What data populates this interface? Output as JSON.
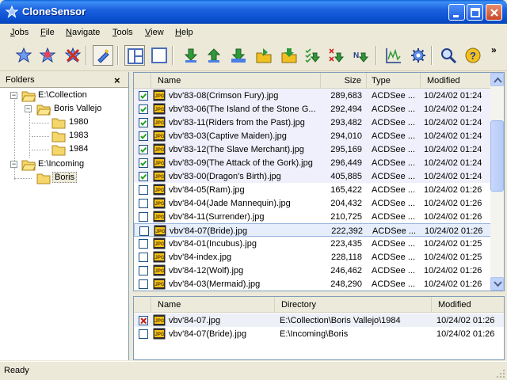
{
  "window": {
    "title": "CloneSensor"
  },
  "menu": [
    {
      "label": "Jobs",
      "u": "J",
      "rest": "obs"
    },
    {
      "label": "File",
      "u": "F",
      "rest": "ile"
    },
    {
      "label": "Navigate",
      "u": "N",
      "rest": "avigate"
    },
    {
      "label": "Tools",
      "u": "T",
      "rest": "ools"
    },
    {
      "label": "View",
      "u": "V",
      "rest": "iew"
    },
    {
      "label": "Help",
      "u": "H",
      "rest": "elp"
    }
  ],
  "toolbar": {
    "icons": [
      "new-job-icon",
      "edit-job-icon",
      "delete-job-icon",
      "auto-mark-icon",
      "split-view-icon",
      "single-view-icon",
      "download-icon",
      "upload-icon",
      "import-icon",
      "open-folder-icon",
      "move-icon",
      "check-all-icon",
      "uncheck-all-icon",
      "next-icon",
      "chart-icon",
      "settings-icon",
      "search-icon",
      "help-icon"
    ],
    "overflow": "»",
    "colors": {
      "green": "#2f9a3a",
      "blue": "#2a5fc8",
      "red": "#d02a20",
      "yellow": "#f0c020"
    }
  },
  "folders": {
    "title": "Folders",
    "close": "×",
    "tree": [
      {
        "label": "E:\\Collection",
        "expander": "−"
      },
      {
        "label": "Boris Vallejo",
        "expander": "−"
      },
      {
        "label": "1980"
      },
      {
        "label": "1983"
      },
      {
        "label": "1984"
      },
      {
        "label": "E:\\Incoming",
        "expander": "−"
      },
      {
        "label": "Boris",
        "selected": true
      }
    ]
  },
  "filelist": {
    "columns": {
      "name": "Name",
      "size": "Size",
      "type": "Type",
      "modified": "Modified"
    },
    "rows": [
      {
        "name": "vbv'83-08(Crimson Fury).jpg",
        "size": "289,683",
        "type": "ACDSee ...",
        "modified": "10/24/02 01:24",
        "checked": true
      },
      {
        "name": "vbv'83-06(The Island of the Stone G...",
        "size": "292,494",
        "type": "ACDSee ...",
        "modified": "10/24/02 01:24",
        "checked": true
      },
      {
        "name": "vbv'83-11(Riders from the Past).jpg",
        "size": "293,482",
        "type": "ACDSee ...",
        "modified": "10/24/02 01:24",
        "checked": true
      },
      {
        "name": "vbv'83-03(Captive Maiden).jpg",
        "size": "294,010",
        "type": "ACDSee ...",
        "modified": "10/24/02 01:24",
        "checked": true
      },
      {
        "name": "vbv'83-12(The Slave Merchant).jpg",
        "size": "295,169",
        "type": "ACDSee ...",
        "modified": "10/24/02 01:24",
        "checked": true
      },
      {
        "name": "vbv'83-09(The Attack of the Gork).jpg",
        "size": "296,449",
        "type": "ACDSee ...",
        "modified": "10/24/02 01:24",
        "checked": true
      },
      {
        "name": "vbv'83-00(Dragon's Birth).jpg",
        "size": "405,885",
        "type": "ACDSee ...",
        "modified": "10/24/02 01:24",
        "checked": true
      },
      {
        "name": "vbv'84-05(Ram).jpg",
        "size": "165,422",
        "type": "ACDSee ...",
        "modified": "10/24/02 01:26",
        "checked": false
      },
      {
        "name": "vbv'84-04(Jade Mannequin).jpg",
        "size": "204,432",
        "type": "ACDSee ...",
        "modified": "10/24/02 01:26",
        "checked": false
      },
      {
        "name": "vbv'84-11(Surrender).jpg",
        "size": "210,725",
        "type": "ACDSee ...",
        "modified": "10/24/02 01:26",
        "checked": false
      },
      {
        "name": "vbv'84-07(Bride).jpg",
        "size": "222,392",
        "type": "ACDSee ...",
        "modified": "10/24/02 01:26",
        "checked": false,
        "highlighted": true
      },
      {
        "name": "vbv'84-01(Incubus).jpg",
        "size": "223,435",
        "type": "ACDSee ...",
        "modified": "10/24/02 01:25",
        "checked": false
      },
      {
        "name": "vbv'84-index.jpg",
        "size": "228,118",
        "type": "ACDSee ...",
        "modified": "10/24/02 01:25",
        "checked": false
      },
      {
        "name": "vbv'84-12(Wolf).jpg",
        "size": "246,462",
        "type": "ACDSee ...",
        "modified": "10/24/02 01:26",
        "checked": false
      },
      {
        "name": "vbv'84-03(Mermaid).jpg",
        "size": "248,290",
        "type": "ACDSee ...",
        "modified": "10/24/02 01:26",
        "checked": false
      }
    ]
  },
  "duplicates": {
    "columns": {
      "name": "Name",
      "directory": "Directory",
      "modified": "Modified"
    },
    "rows": [
      {
        "name": "vbv'84-07.jpg",
        "directory": "E:\\Collection\\Boris Vallejo\\1984",
        "modified": "10/24/02 01:26",
        "state": "delete"
      },
      {
        "name": "vbv'84-07(Bride).jpg",
        "directory": "E:\\Incoming\\Boris",
        "modified": "10/24/02 01:26",
        "state": "none"
      }
    ]
  },
  "status": {
    "text": "Ready"
  }
}
